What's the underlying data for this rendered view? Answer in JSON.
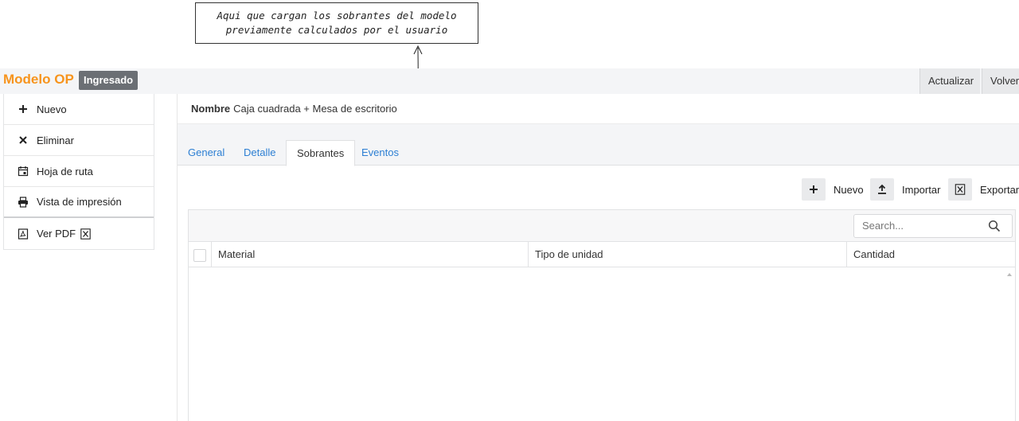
{
  "annotation": {
    "line1": "Aqui que cargan los sobrantes del modelo",
    "line2": "previamente calculados por el usuario"
  },
  "header": {
    "brand": "Modelo OP",
    "status": "Ingresado",
    "actualizar_label": "Actualizar",
    "volver_label": "Volver"
  },
  "sidebar": {
    "items": [
      {
        "label": "Nuevo",
        "icon": "plus-icon"
      },
      {
        "label": "Eliminar",
        "icon": "close-icon"
      },
      {
        "label": "Hoja de ruta",
        "icon": "calendar-icon"
      },
      {
        "label": "Vista de impresión",
        "icon": "printer-icon"
      },
      {
        "label": "Ver PDF",
        "icon": "pdf-icon"
      }
    ]
  },
  "record": {
    "name_label": "Nombre",
    "name_value": "Caja cuadrada + Mesa de escritorio"
  },
  "tabs": [
    {
      "label": "General",
      "active": false
    },
    {
      "label": "Detalle",
      "active": false
    },
    {
      "label": "Sobrantes",
      "active": true
    },
    {
      "label": "Eventos",
      "active": false
    }
  ],
  "toolbar": {
    "nuevo_label": "Nuevo",
    "importar_label": "Importar",
    "exportar_label": "Exportar"
  },
  "grid": {
    "search_placeholder": "Search...",
    "columns": [
      "Material",
      "Tipo de unidad",
      "Cantidad"
    ]
  },
  "colors": {
    "brand": "#f7941d",
    "badge": "#6b6f74",
    "tab_link": "#2d7fd3"
  }
}
